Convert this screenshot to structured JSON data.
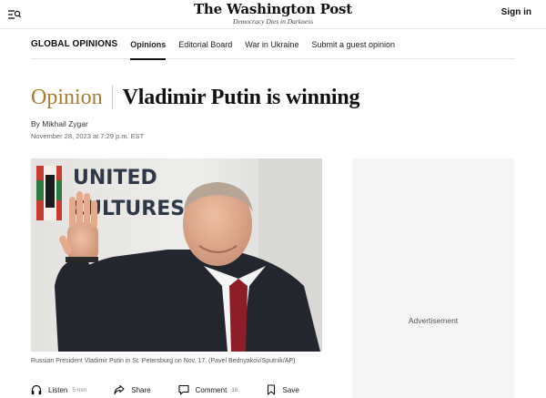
{
  "header": {
    "logo": "The Washington Post",
    "tagline": "Democracy Dies in Darkness",
    "signin_label": "Sign in"
  },
  "section_nav": {
    "title": "GLOBAL OPINIONS",
    "items": [
      {
        "label": "Opinions",
        "active": true
      },
      {
        "label": "Editorial Board",
        "active": false
      },
      {
        "label": "War in Ukraine",
        "active": false
      },
      {
        "label": "Submit a guest opinion",
        "active": false
      }
    ]
  },
  "article": {
    "kicker": "Opinion",
    "title": "Vladimir Putin is winning",
    "byline_prefix": "By",
    "author": "Mikhail Zygar",
    "date": "November 28, 2023 at 7:29 p.m. EST",
    "photo": {
      "backdrop_text": [
        "UNITED",
        "CULTURES"
      ]
    },
    "caption": "Russian President Vladimir Putin in St. Petersburg on Nov. 17. (Pavel Bednyakov/Sputnik/AP)"
  },
  "actions": {
    "listen_label": "Listen",
    "listen_duration": "5 min",
    "share_label": "Share",
    "comment_label": "Comment",
    "comment_count": "16",
    "save_label": "Save"
  },
  "ad": {
    "label": "Advertisement"
  },
  "colors": {
    "kicker": "#a67c2e",
    "ad_background": "#f5f5f5"
  }
}
